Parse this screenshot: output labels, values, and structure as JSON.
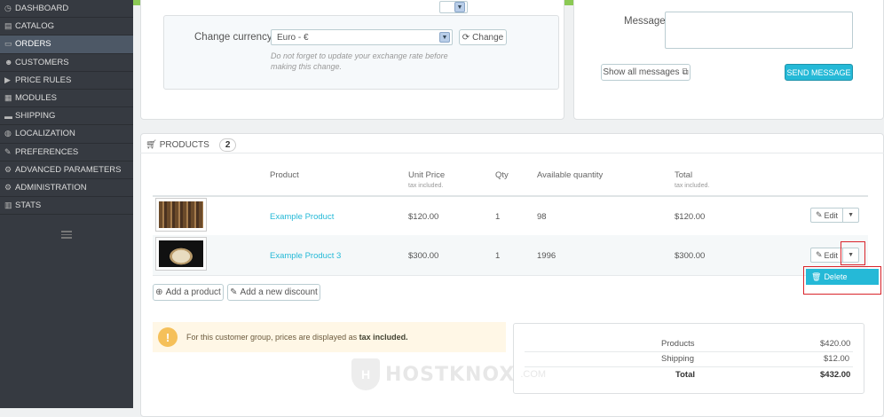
{
  "sidebar": {
    "items": [
      {
        "label": "DASHBOARD",
        "icon": "dashboard-icon"
      },
      {
        "label": "CATALOG",
        "icon": "catalog-icon"
      },
      {
        "label": "ORDERS",
        "icon": "orders-icon",
        "active": true
      },
      {
        "label": "CUSTOMERS",
        "icon": "customers-icon"
      },
      {
        "label": "PRICE RULES",
        "icon": "price-rules-icon"
      },
      {
        "label": "MODULES",
        "icon": "modules-icon"
      },
      {
        "label": "SHIPPING",
        "icon": "shipping-icon"
      },
      {
        "label": "LOCALIZATION",
        "icon": "localization-icon"
      },
      {
        "label": "PREFERENCES",
        "icon": "preferences-icon"
      },
      {
        "label": "ADVANCED PARAMETERS",
        "icon": "advanced-parameters-icon"
      },
      {
        "label": "ADMINISTRATION",
        "icon": "administration-icon"
      },
      {
        "label": "STATS",
        "icon": "stats-icon"
      }
    ]
  },
  "currency": {
    "label": "Change currency",
    "selected": "Euro - €",
    "button": "Change",
    "hint": "Do not forget to update your exchange rate before making this change."
  },
  "messages": {
    "label": "Message",
    "show_all": "Show all messages",
    "send": "SEND MESSAGE"
  },
  "products": {
    "title": "PRODUCTS",
    "count": "2",
    "columns": {
      "product": "Product",
      "unit_price": "Unit Price",
      "unit_price_sub": "tax included.",
      "qty": "Qty",
      "available": "Available quantity",
      "total": "Total",
      "total_sub": "tax included."
    },
    "rows": [
      {
        "name": "Example Product",
        "unit_price": "$120.00",
        "qty": "1",
        "available": "98",
        "total": "$120.00",
        "edit": "Edit"
      },
      {
        "name": "Example Product 3",
        "unit_price": "$300.00",
        "qty": "1",
        "available": "1996",
        "total": "$300.00",
        "edit": "Edit"
      }
    ],
    "delete_label": "Delete",
    "add_product": "Add a product",
    "add_discount": "Add a new discount"
  },
  "alert": {
    "text": "For this customer group, prices are displayed as",
    "emphasis": "tax included."
  },
  "totals": {
    "products_label": "Products",
    "products_value": "$420.00",
    "shipping_label": "Shipping",
    "shipping_value": "$12.00",
    "total_label": "Total",
    "total_value": "$432.00"
  },
  "watermark": {
    "text": "HOSTKNOX",
    "suffix": ".COM"
  },
  "colors": {
    "accent": "#25b9d7",
    "sidebar": "#363a41",
    "highlight": "#d9242b"
  }
}
